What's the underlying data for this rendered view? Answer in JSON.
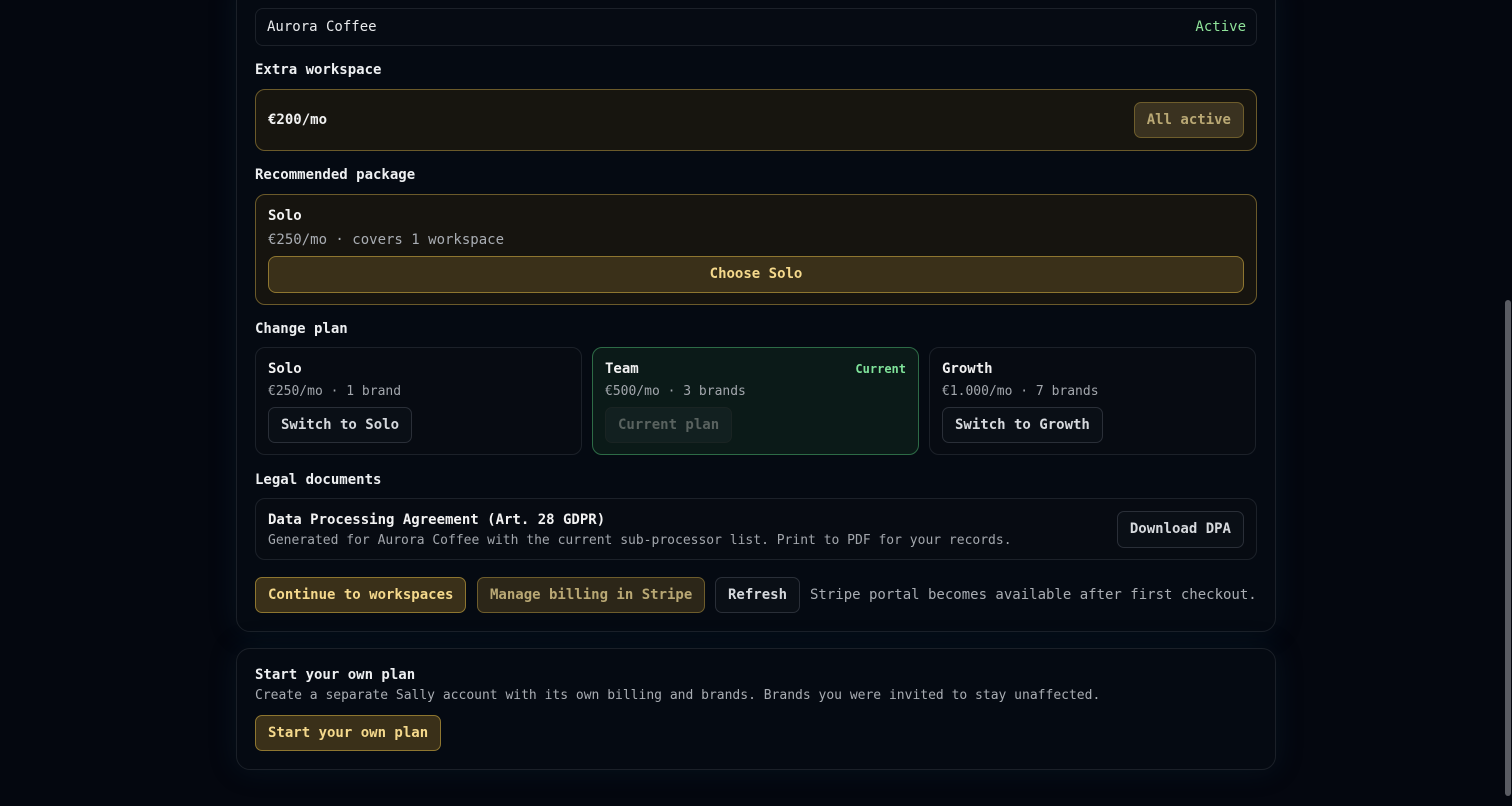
{
  "brand_row": {
    "name": "Aurora Coffee",
    "status": "Active"
  },
  "extra_workspace": {
    "title": "Extra workspace",
    "price": "€200/mo",
    "button_label": "All active"
  },
  "recommended": {
    "title": "Recommended package",
    "name": "Solo",
    "description": "€250/mo · covers 1 workspace",
    "button_label": "Choose Solo"
  },
  "change_plan": {
    "title": "Change plan",
    "plans": [
      {
        "name": "Solo",
        "description": "€250/mo · 1 brand",
        "button_label": "Switch to Solo",
        "tag": ""
      },
      {
        "name": "Team",
        "description": "€500/mo · 3 brands",
        "button_label": "Current plan",
        "tag": "Current"
      },
      {
        "name": "Growth",
        "description": "€1.000/mo · 7 brands",
        "button_label": "Switch to Growth",
        "tag": ""
      }
    ]
  },
  "legal": {
    "title": "Legal documents",
    "doc_title": "Data Processing Agreement (Art. 28 GDPR)",
    "doc_description": "Generated for Aurora Coffee with the current sub-processor list. Print to PDF for your records.",
    "button_label": "Download DPA"
  },
  "actions": {
    "continue_label": "Continue to workspaces",
    "stripe_label": "Manage billing in Stripe",
    "refresh_label": "Refresh",
    "note": "Stripe portal becomes available after first checkout."
  },
  "own_plan": {
    "title": "Start your own plan",
    "description": "Create a separate Sally account with its own billing and brands. Brands you were invited to stay unaffected.",
    "button_label": "Start your own plan"
  },
  "colors": {
    "background": "#04070f",
    "accent_gold": "#f5d98c",
    "status_green": "#8fe39a",
    "current_border": "#2d6b46"
  }
}
